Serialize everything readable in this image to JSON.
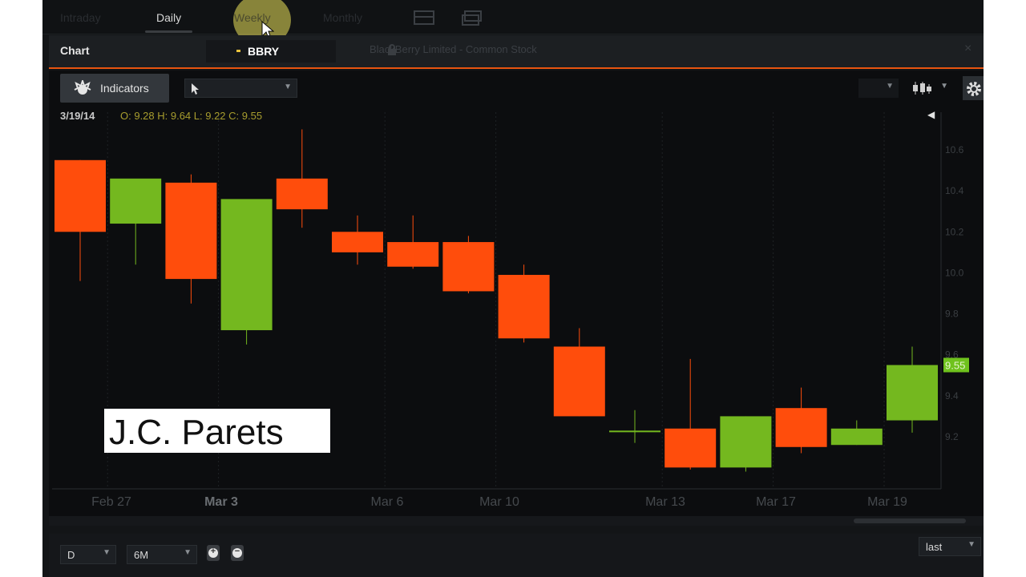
{
  "tabs": [
    {
      "label": "Intraday",
      "state": "dim"
    },
    {
      "label": "Daily",
      "state": "active"
    },
    {
      "label": "Weekly",
      "state": "hover"
    },
    {
      "label": "Monthly",
      "state": "dim"
    }
  ],
  "header": {
    "title": "Chart",
    "symbol_value": "BBRY",
    "company": "BlackBerry Limited - Common Stock"
  },
  "toolbar": {
    "indicators_label": "Indicators"
  },
  "ohlc": {
    "date": "3/19/14",
    "values": "O: 9.28 H: 9.64 L: 9.22 C: 9.55"
  },
  "watermark": "J.C. Parets",
  "bottom": {
    "interval": "D",
    "range": "6M",
    "price_type": "last"
  },
  "colors": {
    "up": "#74b81f",
    "down": "#ff4d0c",
    "accent": "#e8540f",
    "last_price_badge": "#6fc21d"
  },
  "chart_data": {
    "type": "candlestick",
    "ylim": [
      9.0,
      10.75
    ],
    "y_ticks": [
      "10.6",
      "10.4",
      "10.2",
      "10.0",
      "9.8",
      "9.6",
      "9.4",
      "9.2"
    ],
    "x_labels": [
      "Feb 27",
      "Mar 3",
      "Mar 6",
      "Mar 10",
      "Mar 13",
      "Mar 17",
      "Mar 19"
    ],
    "last_price": "9.55",
    "candles": [
      {
        "o": 10.55,
        "h": 10.55,
        "l": 9.96,
        "c": 10.2
      },
      {
        "o": 10.24,
        "h": 10.44,
        "l": 10.04,
        "c": 10.46
      },
      {
        "o": 10.44,
        "h": 10.48,
        "l": 9.85,
        "c": 9.97
      },
      {
        "o": 9.72,
        "h": 10.29,
        "l": 9.65,
        "c": 10.36
      },
      {
        "o": 10.46,
        "h": 10.7,
        "l": 10.22,
        "c": 10.31
      },
      {
        "o": 10.2,
        "h": 10.28,
        "l": 10.04,
        "c": 10.1
      },
      {
        "o": 10.15,
        "h": 10.28,
        "l": 10.02,
        "c": 10.03
      },
      {
        "o": 10.15,
        "h": 10.18,
        "l": 9.9,
        "c": 9.91
      },
      {
        "o": 9.99,
        "h": 10.04,
        "l": 9.66,
        "c": 9.68
      },
      {
        "o": 9.64,
        "h": 9.73,
        "l": 9.3,
        "c": 9.3
      },
      {
        "o": 9.23,
        "h": 9.33,
        "l": 9.17,
        "c": 9.23
      },
      {
        "o": 9.24,
        "h": 9.58,
        "l": 9.04,
        "c": 9.05
      },
      {
        "o": 9.05,
        "h": 9.3,
        "l": 9.03,
        "c": 9.3
      },
      {
        "o": 9.34,
        "h": 9.44,
        "l": 9.12,
        "c": 9.15
      },
      {
        "o": 9.16,
        "h": 9.28,
        "l": 9.16,
        "c": 9.24
      },
      {
        "o": 9.28,
        "h": 9.64,
        "l": 9.22,
        "c": 9.55
      }
    ]
  }
}
